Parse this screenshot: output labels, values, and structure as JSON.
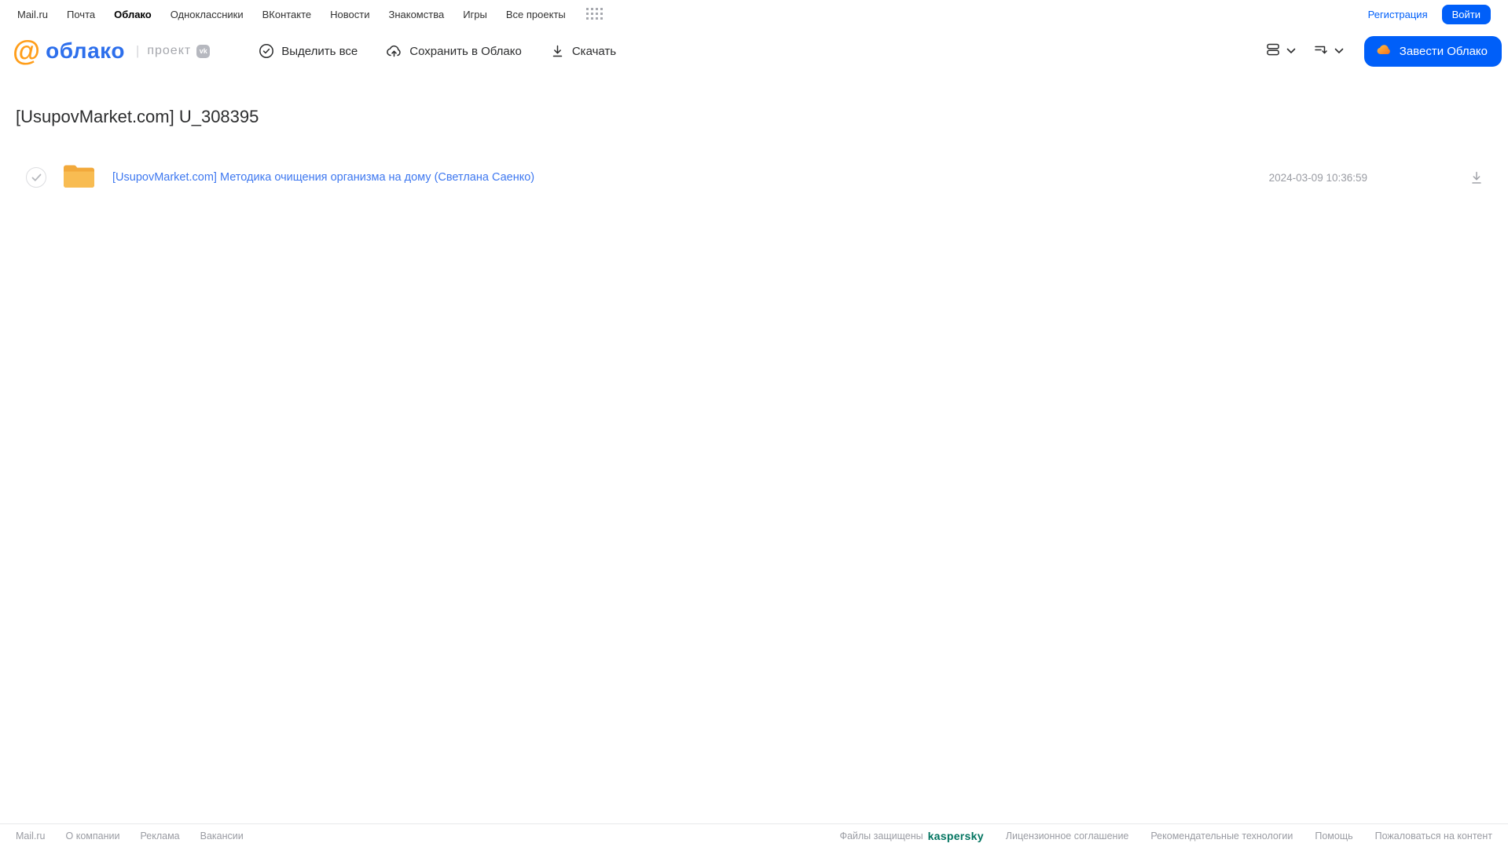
{
  "topbar": {
    "links": [
      "Mail.ru",
      "Почта",
      "Облако",
      "Одноклассники",
      "ВКонтакте",
      "Новости",
      "Знакомства",
      "Игры",
      "Все проекты"
    ],
    "active_link": "Облако",
    "registration_label": "Регистрация",
    "login_label": "Войти"
  },
  "header": {
    "logo_text": "облако",
    "project_label": "проект",
    "vk_badge": "vk",
    "toolbar": {
      "select_all_label": "Выделить все",
      "save_to_cloud_label": "Сохранить в Облако",
      "download_label": "Скачать"
    },
    "create_cloud_label": "Завести Облако"
  },
  "main": {
    "title": "[UsupovMarket.com] U_308395",
    "files": [
      {
        "type": "folder",
        "name": "[UsupovMarket.com] Методика очищения организма на дому (Светлана Саенко)",
        "date": "2024-03-09 10:36:59"
      }
    ]
  },
  "footer": {
    "left_links": [
      "Mail.ru",
      "О компании",
      "Реклама",
      "Вакансии"
    ],
    "protected_text": "Файлы защищены",
    "kaspersky_label": "kaspersky",
    "right_links": [
      "Лицензионное соглашение",
      "Рекомендательные технологии",
      "Помощь",
      "Пожаловаться на контент"
    ]
  },
  "colors": {
    "accent_blue": "#005ff9",
    "link_blue": "#3e78f0",
    "logo_orange": "#ff9e1b",
    "logo_blue": "#2d6fec",
    "folder_yellow": "#f7b63f",
    "kaspersky_teal": "#00735f"
  }
}
